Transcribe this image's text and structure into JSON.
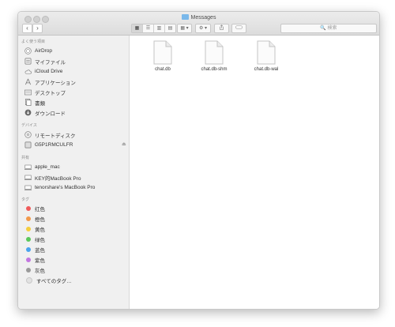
{
  "window": {
    "title": "Messages"
  },
  "toolbar": {
    "back": "‹",
    "forward": "›",
    "view_icons": [
      "▦",
      "☰",
      "▥",
      "▤"
    ],
    "arrange": "▦ ▾",
    "action": "⚙ ▾",
    "search_placeholder": "🔍 検索"
  },
  "sidebar": {
    "favorites_header": "よく使う項目",
    "favorites": [
      {
        "label": "AirDrop",
        "icon": "airdrop-icon"
      },
      {
        "label": "マイファイル",
        "icon": "all-files-icon"
      },
      {
        "label": "iCloud Drive",
        "icon": "cloud-icon"
      },
      {
        "label": "アプリケーション",
        "icon": "applications-icon"
      },
      {
        "label": "デスクトップ",
        "icon": "desktop-icon"
      },
      {
        "label": "書類",
        "icon": "documents-icon"
      },
      {
        "label": "ダウンロード",
        "icon": "downloads-icon"
      }
    ],
    "devices_header": "デバイス",
    "devices": [
      {
        "label": "リモートディスク",
        "icon": "remote-disc-icon"
      },
      {
        "label": "G5P1RMCULFR",
        "icon": "drive-icon",
        "eject": "⏏"
      }
    ],
    "shared_header": "共有",
    "shared": [
      {
        "label": "apple_mac",
        "icon": "computer-icon"
      },
      {
        "label": "KEY的MacBook Pro",
        "icon": "computer-icon"
      },
      {
        "label": "tenorshare's MacBook Pro",
        "icon": "computer-icon"
      }
    ],
    "tags_header": "タグ",
    "tags": [
      {
        "label": "红色",
        "color": "#f05a5a"
      },
      {
        "label": "橙色",
        "color": "#f2994a"
      },
      {
        "label": "黄色",
        "color": "#f5cd3d"
      },
      {
        "label": "绿色",
        "color": "#5ac85a"
      },
      {
        "label": "蓝色",
        "color": "#4aa3ee"
      },
      {
        "label": "紫色",
        "color": "#c276e0"
      },
      {
        "label": "灰色",
        "color": "#9a9a9a"
      },
      {
        "label": "すべてのタグ…",
        "color": "#e2e2e2"
      }
    ]
  },
  "files": [
    {
      "name": "chat.db"
    },
    {
      "name": "chat.db-shm"
    },
    {
      "name": "chat.db-wal"
    }
  ]
}
